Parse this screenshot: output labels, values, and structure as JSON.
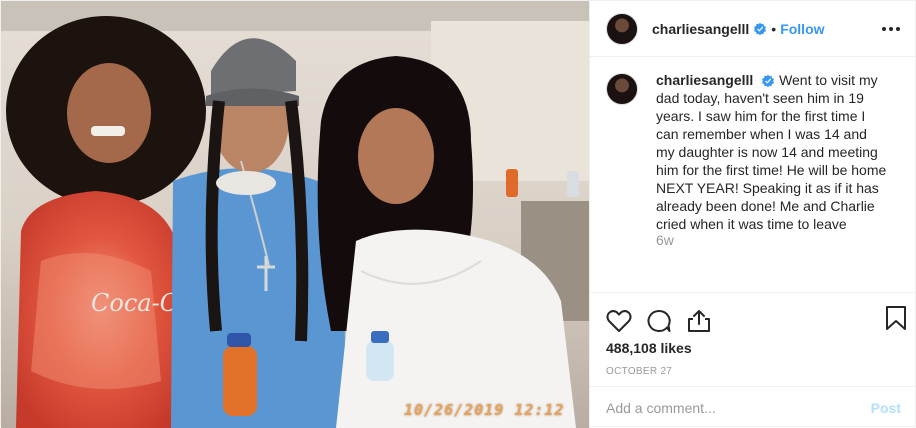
{
  "photo": {
    "date_stamp": "10/26/2019  12:12",
    "shirt_text": "Coca-Cola"
  },
  "header": {
    "username": "charliesangelll",
    "separator": "•",
    "follow_label": "Follow",
    "more_icon": "more-horizontal-icon"
  },
  "caption": {
    "username": "charliesangelll",
    "text": "Went to visit my dad today, haven't seen him in 19 years. I saw him for the first time I can remember when I was 14 and my daughter is now 14 and meeting him for the first time! He will be home NEXT YEAR! Speaking it as if it has already been done! Me and Charlie cried when it was time to leave",
    "age": "6w"
  },
  "actions": {
    "icons": [
      "heart-icon",
      "comment-icon",
      "share-icon",
      "bookmark-icon"
    ],
    "likes": "488,108 likes",
    "date": "October 27"
  },
  "comment": {
    "placeholder": "Add a comment...",
    "post_label": "Post"
  },
  "colors": {
    "link_blue": "#3897f0",
    "post_disabled": "#b2dffc",
    "muted_text": "#999999",
    "border": "#efefef"
  }
}
